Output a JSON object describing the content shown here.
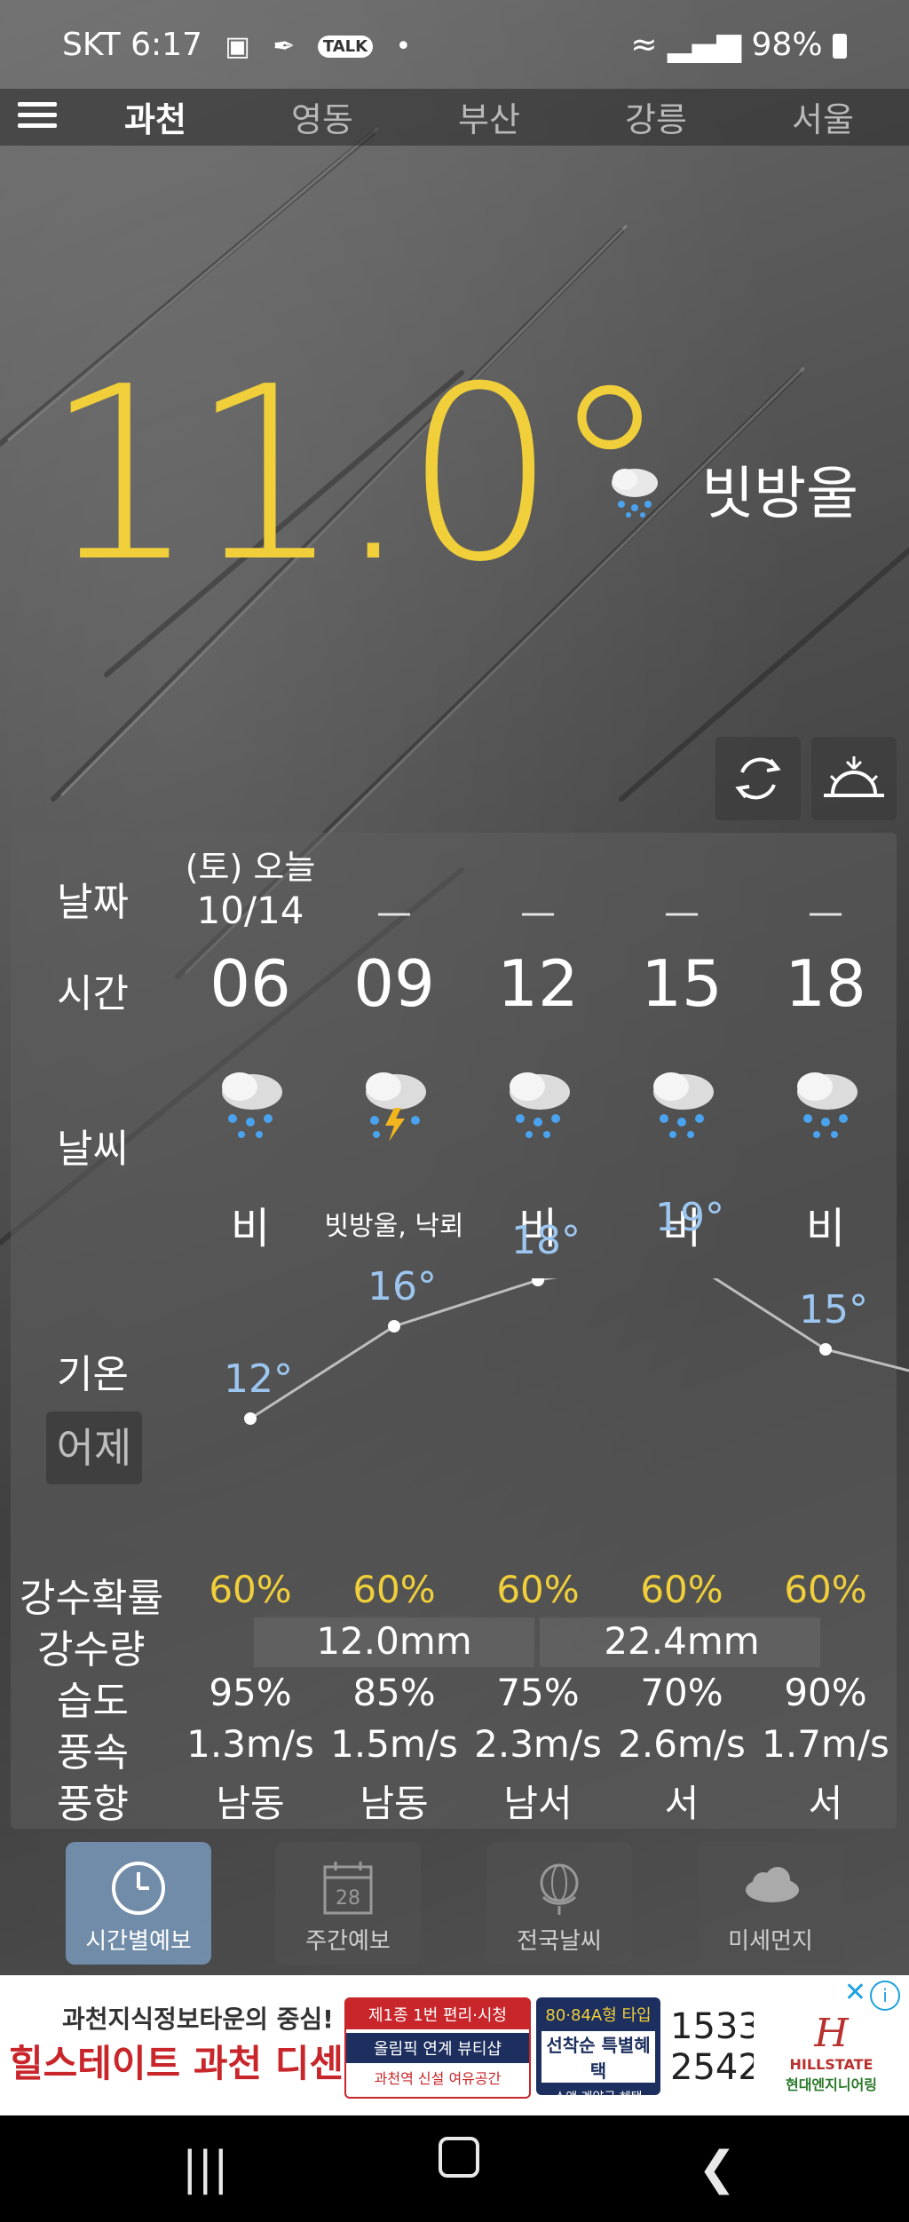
{
  "status_bar": {
    "carrier_time": "SKT 6:17",
    "battery": "98%",
    "talk_badge": "TALK"
  },
  "tabs": [
    "과천",
    "영동",
    "부산",
    "강릉",
    "서울"
  ],
  "current": {
    "temperature": "11.0°",
    "condition": "빗방울"
  },
  "forecast": {
    "labels": {
      "date": "날짜",
      "time": "시간",
      "weather": "날씨",
      "temp": "기온",
      "yesterday": "어제",
      "precip_prob": "강수확률",
      "precip_amount": "강수량",
      "humidity": "습도",
      "wind_speed": "풍속",
      "wind_dir": "풍향"
    },
    "date_top": "(토) 오늘",
    "date": "10/14",
    "dash": "—",
    "hours": [
      "06",
      "09",
      "12",
      "15",
      "18"
    ],
    "weather": [
      "비",
      "빗방울, 낙뢰",
      "비",
      "비",
      "비"
    ],
    "icons": [
      "rain-cloud-icon",
      "thunder-cloud-icon",
      "rain-cloud-icon",
      "rain-cloud-icon",
      "rain-cloud-icon"
    ],
    "temps": [
      "12°",
      "16°",
      "18°",
      "19°",
      "15°"
    ],
    "temp_values": [
      12,
      16,
      18,
      19,
      15
    ],
    "precip_prob": [
      "60%",
      "60%",
      "60%",
      "60%",
      "60%"
    ],
    "precip_amount": [
      "12.0mm",
      "22.4mm"
    ],
    "humidity": [
      "95%",
      "85%",
      "75%",
      "70%",
      "90%"
    ],
    "wind_speed": [
      "1.3m/s",
      "1.5m/s",
      "2.3m/s",
      "2.6m/s",
      "1.7m/s"
    ],
    "wind_dir": [
      "남동",
      "남동",
      "남서",
      "서",
      "서"
    ]
  },
  "bottom_nav": {
    "items": [
      "시간별예보",
      "주간예보",
      "전국날씨",
      "미세먼지"
    ],
    "calendar_day": "28"
  },
  "ad": {
    "line1": "과천지식정보타운의 중심!",
    "line2": "힐스테이트 과천 디센트로",
    "box1_a": "제1종 1번 편리·시청",
    "box1_b": "올림픽 연계 뷰티샵",
    "box1_c": "과천역 신설 여유공간",
    "box2_a": "80·84A형 타입",
    "box2_b": "선착순 특별혜택",
    "box2_c": "소액 계약금 혜택",
    "phone_1": "1533",
    "phone_2": "2542",
    "brand": "HILLSTATE",
    "brand_sub": "현대엔지니어링"
  },
  "colors": {
    "accent_yellow": "#f0cf3a",
    "temp_blue": "#9cc6f0"
  }
}
